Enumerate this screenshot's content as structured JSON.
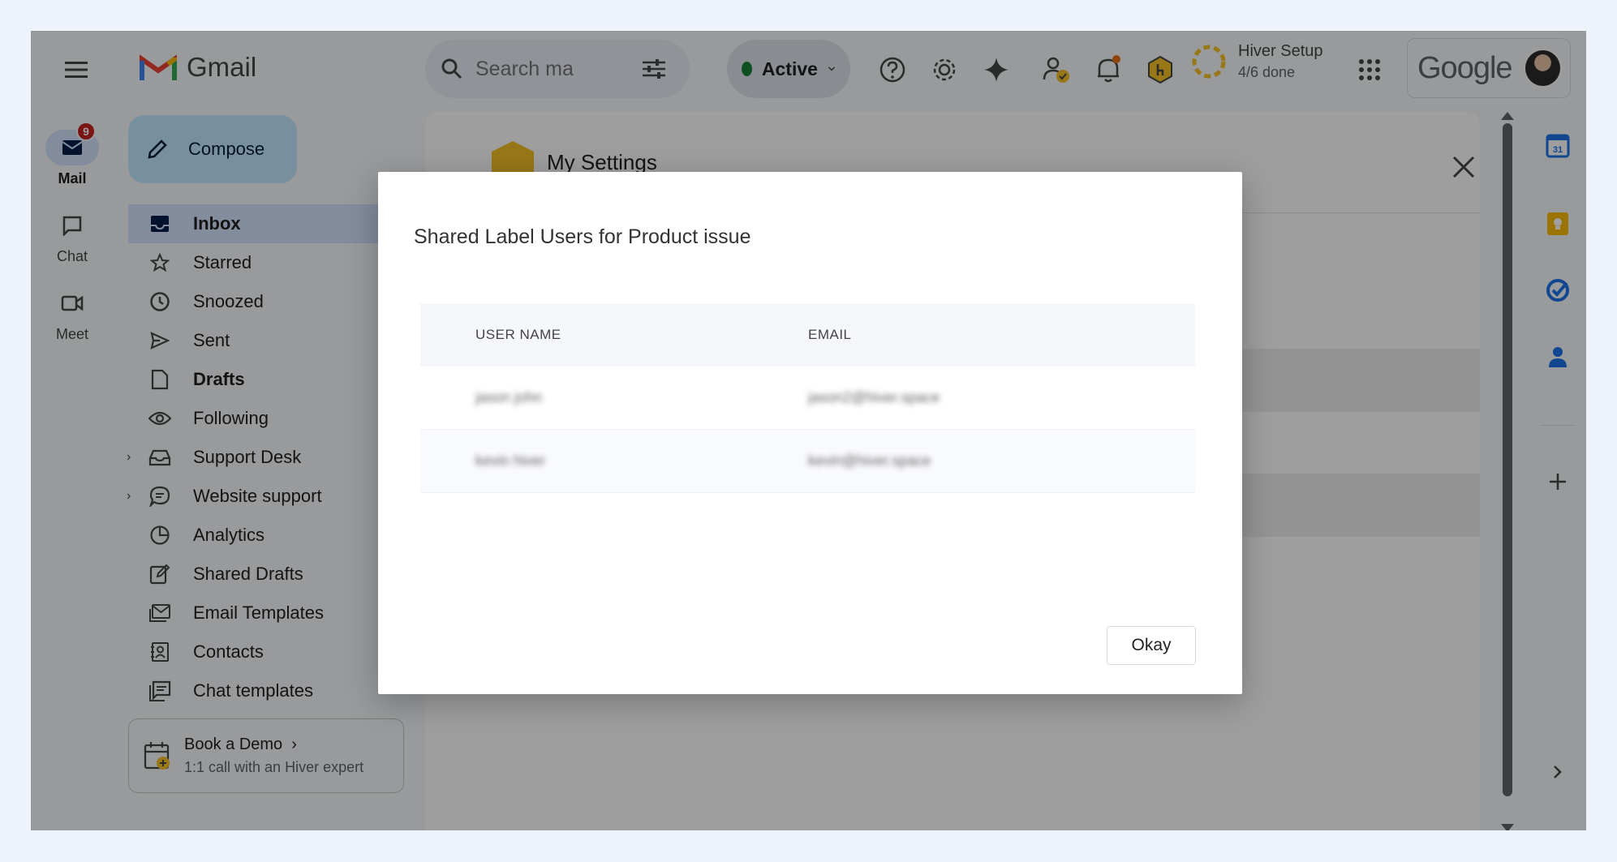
{
  "app": {
    "name": "Gmail"
  },
  "search": {
    "placeholder": "Search ma"
  },
  "status": {
    "label": "Active"
  },
  "setup": {
    "title": "Hiver Setup",
    "progress": "4/6 done"
  },
  "account": {
    "brand": "Google"
  },
  "rail": {
    "mail": {
      "label": "Mail",
      "badge": "9"
    },
    "chat": {
      "label": "Chat"
    },
    "meet": {
      "label": "Meet"
    }
  },
  "compose": {
    "label": "Compose"
  },
  "nav": {
    "items": [
      {
        "label": "Inbox",
        "icon": "inbox-icon"
      },
      {
        "label": "Starred",
        "icon": "star-icon"
      },
      {
        "label": "Snoozed",
        "icon": "clock-icon"
      },
      {
        "label": "Sent",
        "icon": "send-icon"
      },
      {
        "label": "Drafts",
        "icon": "draft-icon"
      },
      {
        "label": "Following",
        "icon": "eye-icon"
      },
      {
        "label": "Support Desk",
        "icon": "tray-icon"
      },
      {
        "label": "Website support",
        "icon": "chat-bubble-icon"
      },
      {
        "label": "Analytics",
        "icon": "pie-chart-icon"
      },
      {
        "label": "Shared Drafts",
        "icon": "edit-icon"
      },
      {
        "label": "Email Templates",
        "icon": "email-template-icon"
      },
      {
        "label": "Contacts",
        "icon": "contacts-icon"
      },
      {
        "label": "Chat templates",
        "icon": "chat-template-icon"
      }
    ]
  },
  "demo": {
    "title": "Book a Demo",
    "subtitle": "1:1 call with an Hiver expert"
  },
  "settings": {
    "title": "My Settings"
  },
  "modal": {
    "title": "Shared Label Users for Product issue",
    "columns": {
      "user": "USER NAME",
      "email": "EMAIL"
    },
    "rows": [
      {
        "user": "jason john",
        "email": "jason2@hiver.space"
      },
      {
        "user": "kevin hiver",
        "email": "kevin@hiver.space"
      }
    ],
    "okay_label": "Okay"
  },
  "colors": {
    "accent": "#c2e7ff",
    "nav_active": "#d3e3fd",
    "status_dot": "#188038",
    "badge": "#c5221f",
    "hiver_yellow": "#f6c026"
  }
}
